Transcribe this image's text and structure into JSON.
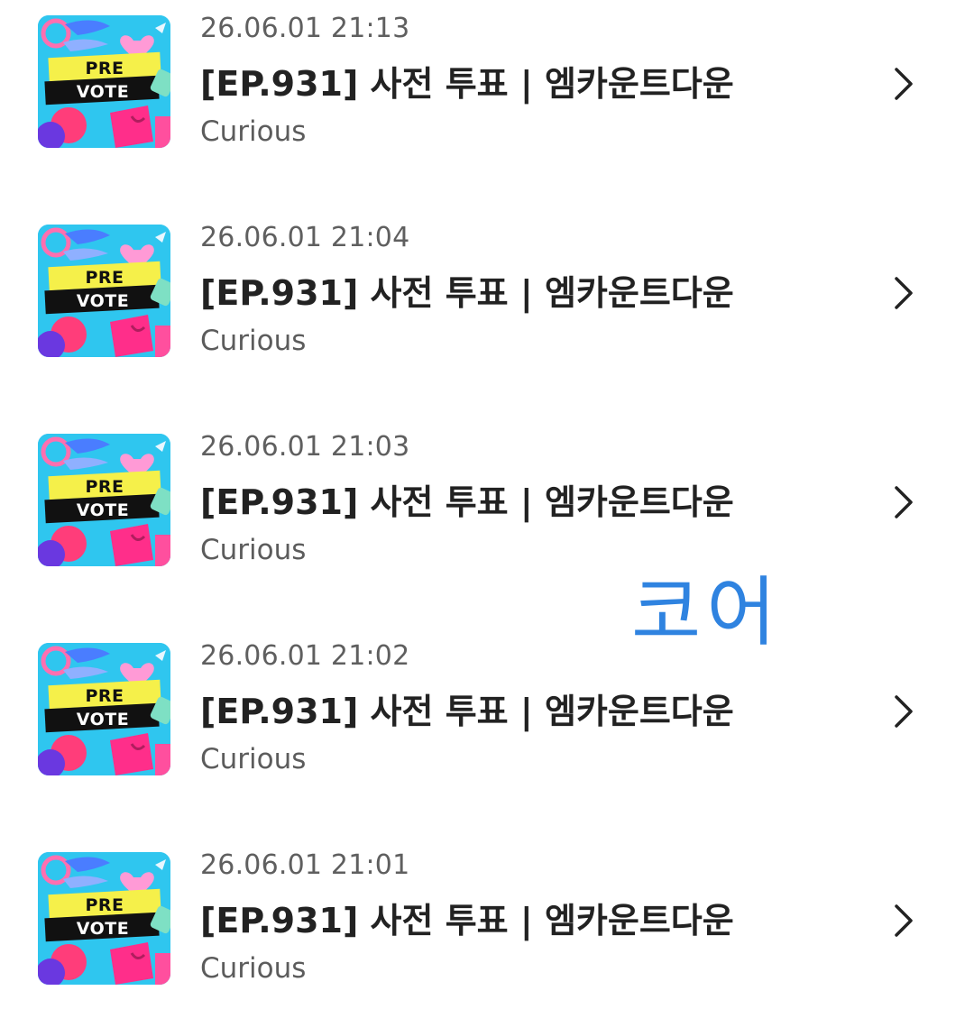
{
  "items": [
    {
      "thumb": {
        "line1": "PRE",
        "line2": "VOTE"
      },
      "date": "26.06.01 21:13",
      "title": "[EP.931] 사전 투표 | 엠카운트다운",
      "artist": "Curious"
    },
    {
      "thumb": {
        "line1": "PRE",
        "line2": "VOTE"
      },
      "date": "26.06.01 21:04",
      "title": "[EP.931] 사전 투표 | 엠카운트다운",
      "artist": "Curious"
    },
    {
      "thumb": {
        "line1": "PRE",
        "line2": "VOTE"
      },
      "date": "26.06.01 21:03",
      "title": "[EP.931] 사전 투표 | 엠카운트다운",
      "artist": "Curious"
    },
    {
      "thumb": {
        "line1": "PRE",
        "line2": "VOTE"
      },
      "date": "26.06.01 21:02",
      "title": "[EP.931] 사전 투표 | 엠카운트다운",
      "artist": "Curious"
    },
    {
      "thumb": {
        "line1": "PRE",
        "line2": "VOTE"
      },
      "date": "26.06.01 21:01",
      "title": "[EP.931] 사전 투표 | 엠카운트다운",
      "artist": "Curious"
    }
  ],
  "watermark": "코어",
  "icons": {
    "thumbnail": "pre-vote-thumbnail",
    "chevron": "chevron-right-icon"
  },
  "colors": {
    "title": "#222222",
    "date": "#5f5f5f",
    "artist": "#5c5c5c",
    "watermark": "#2f83e0",
    "thumb_bg": "#2ec9f0",
    "vote_yellow": "#f5f04a",
    "vote_black": "#111111"
  }
}
